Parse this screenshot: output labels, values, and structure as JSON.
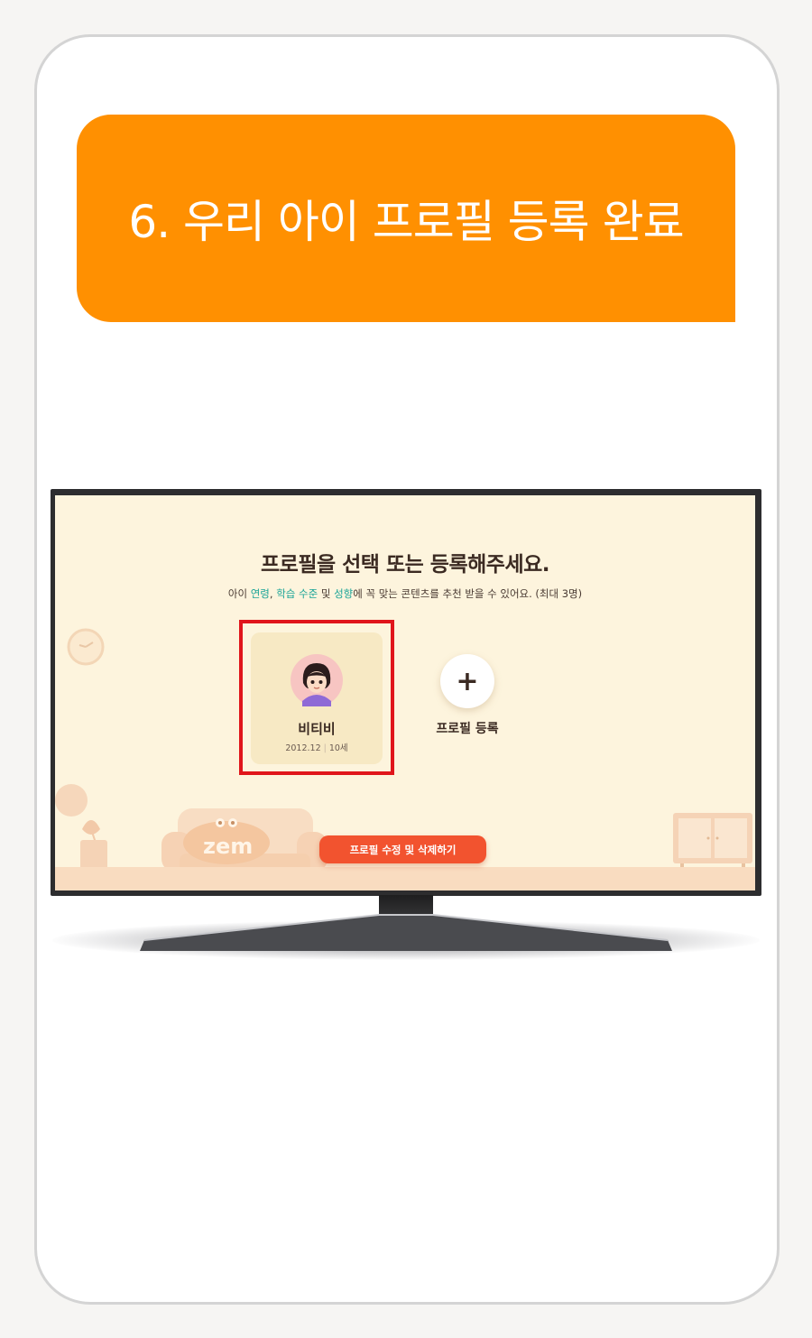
{
  "banner": {
    "title": "6. 우리 아이 프로필 등록 완료"
  },
  "tv_screen": {
    "title": "프로필을 선택 또는 등록해주세요.",
    "subtitle": {
      "p1": "아이 ",
      "hl1": "연령",
      "p2": ", ",
      "hl2": "학습 수준",
      "p3": " 및 ",
      "hl3": "성향",
      "p4": "에 꼭 맞는 콘텐츠를 추천 받을 수 있어요. (최대 3명)"
    },
    "profile": {
      "name": "비티비",
      "birth": "2012.12",
      "age": "10세"
    },
    "add_profile_label": "프로필 등록",
    "add_icon": "+",
    "edit_button_label": "프로필 수정 및 삭제하기",
    "logo_text": "zem"
  },
  "colors": {
    "banner": "#ff9001",
    "highlight": "#e0151b",
    "accent_teal": "#1aa497",
    "button": "#f2532f",
    "screen_bg": "#fdf4dd"
  }
}
